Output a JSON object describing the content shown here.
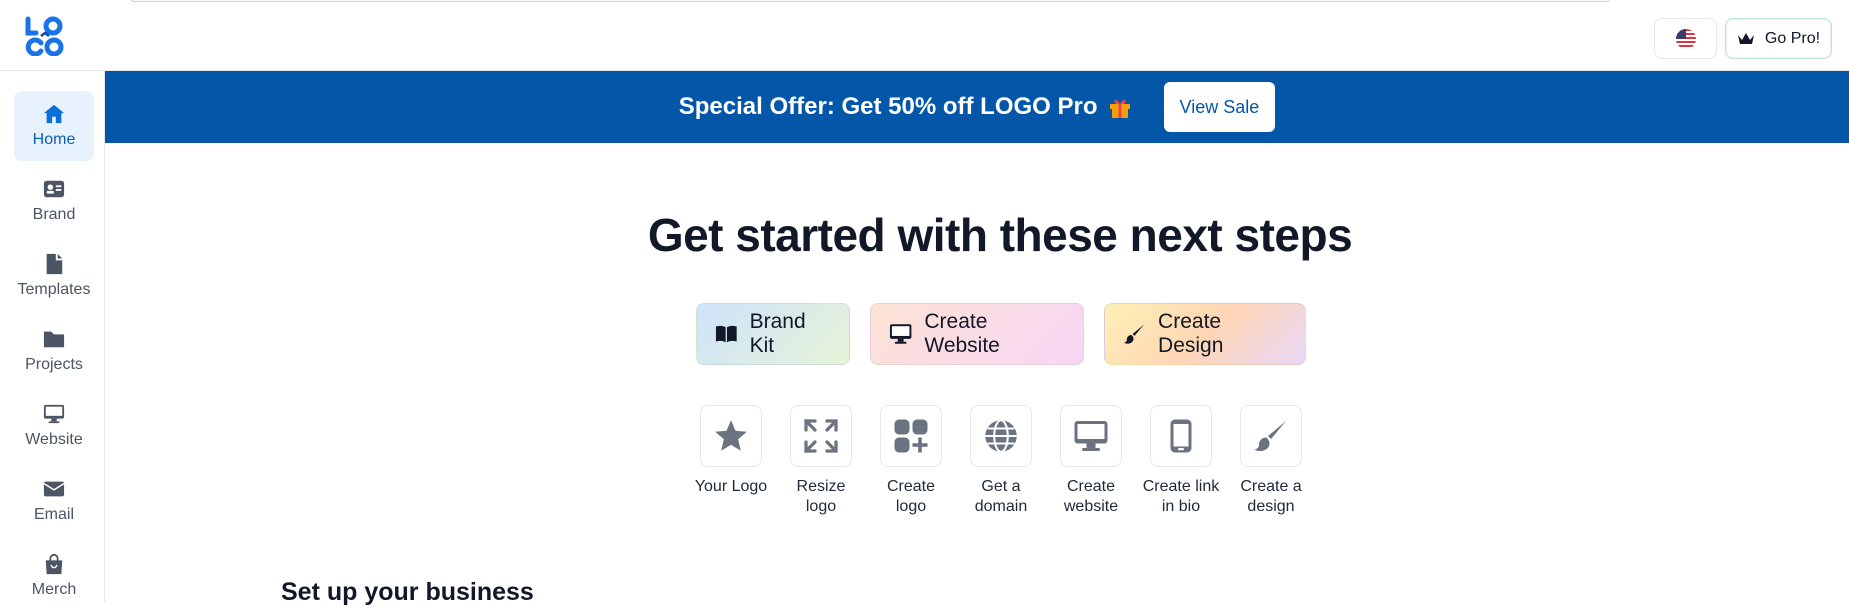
{
  "header": {
    "logo_text": "LOGO",
    "flag_icon": "us-flag-icon",
    "gopro_label": "Go Pro!"
  },
  "sidebar": {
    "items": [
      {
        "label": "Home",
        "icon": "home-icon",
        "active": true
      },
      {
        "label": "Brand",
        "icon": "id-card-icon"
      },
      {
        "label": "Templates",
        "icon": "file-icon"
      },
      {
        "label": "Projects",
        "icon": "folder-icon"
      },
      {
        "label": "Website",
        "icon": "monitor-icon"
      },
      {
        "label": "Email",
        "icon": "envelope-icon"
      },
      {
        "label": "Merch",
        "icon": "shopping-bag-icon"
      }
    ]
  },
  "banner": {
    "text": "Special Offer: Get 50% off LOGO Pro",
    "icon": "gift-icon",
    "button_label": "View Sale"
  },
  "main": {
    "heading": "Get started with these next steps",
    "pills": [
      {
        "label": "Brand Kit",
        "icon": "book-icon"
      },
      {
        "label": "Create Website",
        "icon": "monitor-icon"
      },
      {
        "label": "Create Design",
        "icon": "paintbrush-icon"
      }
    ],
    "tools": [
      {
        "label_1": "Your Logo",
        "label_2": "",
        "icon": "star-icon"
      },
      {
        "label_1": "Resize",
        "label_2": "logo",
        "icon": "expand-icon"
      },
      {
        "label_1": "Create",
        "label_2": "logo",
        "icon": "shapes-plus-icon"
      },
      {
        "label_1": "Get a",
        "label_2": "domain",
        "icon": "globe-icon"
      },
      {
        "label_1": "Create",
        "label_2": "website",
        "icon": "monitor-icon"
      },
      {
        "label_1": "Create link",
        "label_2": "in bio",
        "icon": "phone-icon"
      },
      {
        "label_1": "Create a",
        "label_2": "design",
        "icon": "paintbrush-icon"
      }
    ],
    "section_title": "Set up your business"
  },
  "colors": {
    "brand_blue": "#0457a8",
    "active_bg": "#e8f2fd",
    "icon_gray": "#6b7280"
  }
}
